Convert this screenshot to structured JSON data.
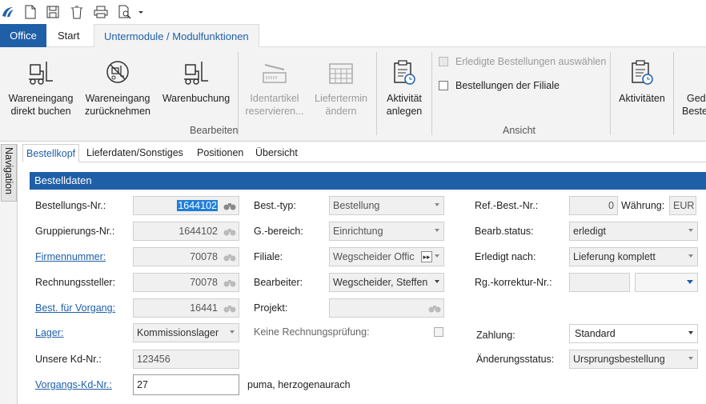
{
  "ribbon_tabs": {
    "office": "Office",
    "start": "Start",
    "module": "Untermodule / Modulfunktionen"
  },
  "ribbon": {
    "wareneingang_buchen": [
      "Wareneingang",
      "direkt buchen"
    ],
    "wareneingang_zurueck": [
      "Wareneingang",
      "zurücknehmen"
    ],
    "warenbuchung": [
      "Warenbuchung"
    ],
    "identartikel": [
      "Identartikel",
      "reservieren..."
    ],
    "liefertermin": [
      "Liefertermin",
      "ändern"
    ],
    "aktivitaet": [
      "Aktivität",
      "anlegen"
    ],
    "group_bearbeiten": "Bearbeiten",
    "chk_erledigte": "Erledigte Bestellungen auswählen",
    "chk_filiale": "Bestellungen der Filiale",
    "group_ansicht": "Ansicht",
    "aktivitaeten": "Aktivitäten",
    "ged_1": "Ged",
    "ged_2": "Beste"
  },
  "nav": {
    "label": "Navigation"
  },
  "subtabs": [
    "Bestellkopf",
    "Lieferdaten/Sonstiges",
    "Positionen",
    "Übersicht"
  ],
  "section": {
    "title": "Bestelldaten"
  },
  "left": {
    "bestellnr_label": "Bestellungs-Nr.:",
    "bestellnr": "1644102",
    "gruppnr_label": "Gruppierungs-Nr.:",
    "gruppnr": "1644102",
    "firmennr_label": "Firmennummer:",
    "firmennr": "70078",
    "rechnungssteller_label": "Rechnungssteller:",
    "rechnungssteller": "70078",
    "bestvorgang_label": "Best. für Vorgang:",
    "bestvorgang": "16441",
    "lager_label": "Lager:",
    "lager": "Kommissionslager",
    "kdnr_label": "Unsere Kd-Nr.:",
    "kdnr": "123456",
    "vorgkdnr_label": "Vorgangs-Kd-Nr.:",
    "vorgkdnr": "27",
    "vorgkdnr_text": "puma, herzogenaurach"
  },
  "middle": {
    "besttyp_label": "Best.-typ:",
    "besttyp": "Bestellung",
    "gbereich_label": "G.-bereich:",
    "gbereich": "Einrichtung",
    "filiale_label": "Filiale:",
    "filiale": "Wegscheider Offic",
    "bearbeiter_label": "Bearbeiter:",
    "bearbeiter": "Wegscheider, Steffen",
    "projekt_label": "Projekt:",
    "keine_rp_label": "Keine Rechnungsprüfung:"
  },
  "right": {
    "refbest_label": "Ref.-Best.-Nr.:",
    "refbest": "0",
    "waehrung_label": "Währung:",
    "waehrung": "EUR",
    "bearbstatus_label": "Bearb.status:",
    "bearbstatus": "erledigt",
    "erledigt_label": "Erledigt nach:",
    "erledigt": "Lieferung komplett",
    "rgkorr_label": "Rg.-korrektur-Nr.:",
    "zahlung_label": "Zahlung:",
    "zahlung": "Standard",
    "aenderung_label": "Änderungsstatus:",
    "aenderung": "Ursprungsbestellung"
  },
  "colors": {
    "accent": "#1f5fa8",
    "ribbon_bg": "#f3f3f3",
    "field_bg": "#f0f0f0"
  }
}
